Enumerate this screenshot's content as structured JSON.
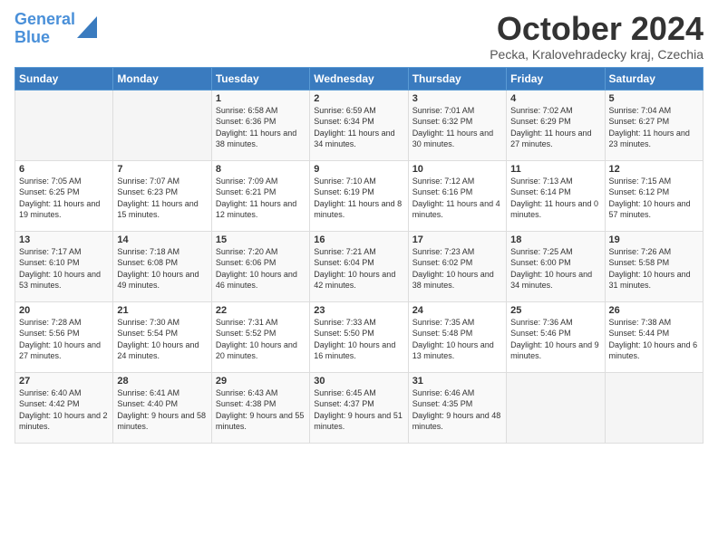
{
  "header": {
    "logo_line1": "General",
    "logo_line2": "Blue",
    "month": "October 2024",
    "location": "Pecka, Kralovehradecky kraj, Czechia"
  },
  "weekdays": [
    "Sunday",
    "Monday",
    "Tuesday",
    "Wednesday",
    "Thursday",
    "Friday",
    "Saturday"
  ],
  "weeks": [
    [
      {
        "day": "",
        "content": ""
      },
      {
        "day": "",
        "content": ""
      },
      {
        "day": "1",
        "content": "Sunrise: 6:58 AM\nSunset: 6:36 PM\nDaylight: 11 hours and 38 minutes."
      },
      {
        "day": "2",
        "content": "Sunrise: 6:59 AM\nSunset: 6:34 PM\nDaylight: 11 hours and 34 minutes."
      },
      {
        "day": "3",
        "content": "Sunrise: 7:01 AM\nSunset: 6:32 PM\nDaylight: 11 hours and 30 minutes."
      },
      {
        "day": "4",
        "content": "Sunrise: 7:02 AM\nSunset: 6:29 PM\nDaylight: 11 hours and 27 minutes."
      },
      {
        "day": "5",
        "content": "Sunrise: 7:04 AM\nSunset: 6:27 PM\nDaylight: 11 hours and 23 minutes."
      }
    ],
    [
      {
        "day": "6",
        "content": "Sunrise: 7:05 AM\nSunset: 6:25 PM\nDaylight: 11 hours and 19 minutes."
      },
      {
        "day": "7",
        "content": "Sunrise: 7:07 AM\nSunset: 6:23 PM\nDaylight: 11 hours and 15 minutes."
      },
      {
        "day": "8",
        "content": "Sunrise: 7:09 AM\nSunset: 6:21 PM\nDaylight: 11 hours and 12 minutes."
      },
      {
        "day": "9",
        "content": "Sunrise: 7:10 AM\nSunset: 6:19 PM\nDaylight: 11 hours and 8 minutes."
      },
      {
        "day": "10",
        "content": "Sunrise: 7:12 AM\nSunset: 6:16 PM\nDaylight: 11 hours and 4 minutes."
      },
      {
        "day": "11",
        "content": "Sunrise: 7:13 AM\nSunset: 6:14 PM\nDaylight: 11 hours and 0 minutes."
      },
      {
        "day": "12",
        "content": "Sunrise: 7:15 AM\nSunset: 6:12 PM\nDaylight: 10 hours and 57 minutes."
      }
    ],
    [
      {
        "day": "13",
        "content": "Sunrise: 7:17 AM\nSunset: 6:10 PM\nDaylight: 10 hours and 53 minutes."
      },
      {
        "day": "14",
        "content": "Sunrise: 7:18 AM\nSunset: 6:08 PM\nDaylight: 10 hours and 49 minutes."
      },
      {
        "day": "15",
        "content": "Sunrise: 7:20 AM\nSunset: 6:06 PM\nDaylight: 10 hours and 46 minutes."
      },
      {
        "day": "16",
        "content": "Sunrise: 7:21 AM\nSunset: 6:04 PM\nDaylight: 10 hours and 42 minutes."
      },
      {
        "day": "17",
        "content": "Sunrise: 7:23 AM\nSunset: 6:02 PM\nDaylight: 10 hours and 38 minutes."
      },
      {
        "day": "18",
        "content": "Sunrise: 7:25 AM\nSunset: 6:00 PM\nDaylight: 10 hours and 34 minutes."
      },
      {
        "day": "19",
        "content": "Sunrise: 7:26 AM\nSunset: 5:58 PM\nDaylight: 10 hours and 31 minutes."
      }
    ],
    [
      {
        "day": "20",
        "content": "Sunrise: 7:28 AM\nSunset: 5:56 PM\nDaylight: 10 hours and 27 minutes."
      },
      {
        "day": "21",
        "content": "Sunrise: 7:30 AM\nSunset: 5:54 PM\nDaylight: 10 hours and 24 minutes."
      },
      {
        "day": "22",
        "content": "Sunrise: 7:31 AM\nSunset: 5:52 PM\nDaylight: 10 hours and 20 minutes."
      },
      {
        "day": "23",
        "content": "Sunrise: 7:33 AM\nSunset: 5:50 PM\nDaylight: 10 hours and 16 minutes."
      },
      {
        "day": "24",
        "content": "Sunrise: 7:35 AM\nSunset: 5:48 PM\nDaylight: 10 hours and 13 minutes."
      },
      {
        "day": "25",
        "content": "Sunrise: 7:36 AM\nSunset: 5:46 PM\nDaylight: 10 hours and 9 minutes."
      },
      {
        "day": "26",
        "content": "Sunrise: 7:38 AM\nSunset: 5:44 PM\nDaylight: 10 hours and 6 minutes."
      }
    ],
    [
      {
        "day": "27",
        "content": "Sunrise: 6:40 AM\nSunset: 4:42 PM\nDaylight: 10 hours and 2 minutes."
      },
      {
        "day": "28",
        "content": "Sunrise: 6:41 AM\nSunset: 4:40 PM\nDaylight: 9 hours and 58 minutes."
      },
      {
        "day": "29",
        "content": "Sunrise: 6:43 AM\nSunset: 4:38 PM\nDaylight: 9 hours and 55 minutes."
      },
      {
        "day": "30",
        "content": "Sunrise: 6:45 AM\nSunset: 4:37 PM\nDaylight: 9 hours and 51 minutes."
      },
      {
        "day": "31",
        "content": "Sunrise: 6:46 AM\nSunset: 4:35 PM\nDaylight: 9 hours and 48 minutes."
      },
      {
        "day": "",
        "content": ""
      },
      {
        "day": "",
        "content": ""
      }
    ]
  ]
}
